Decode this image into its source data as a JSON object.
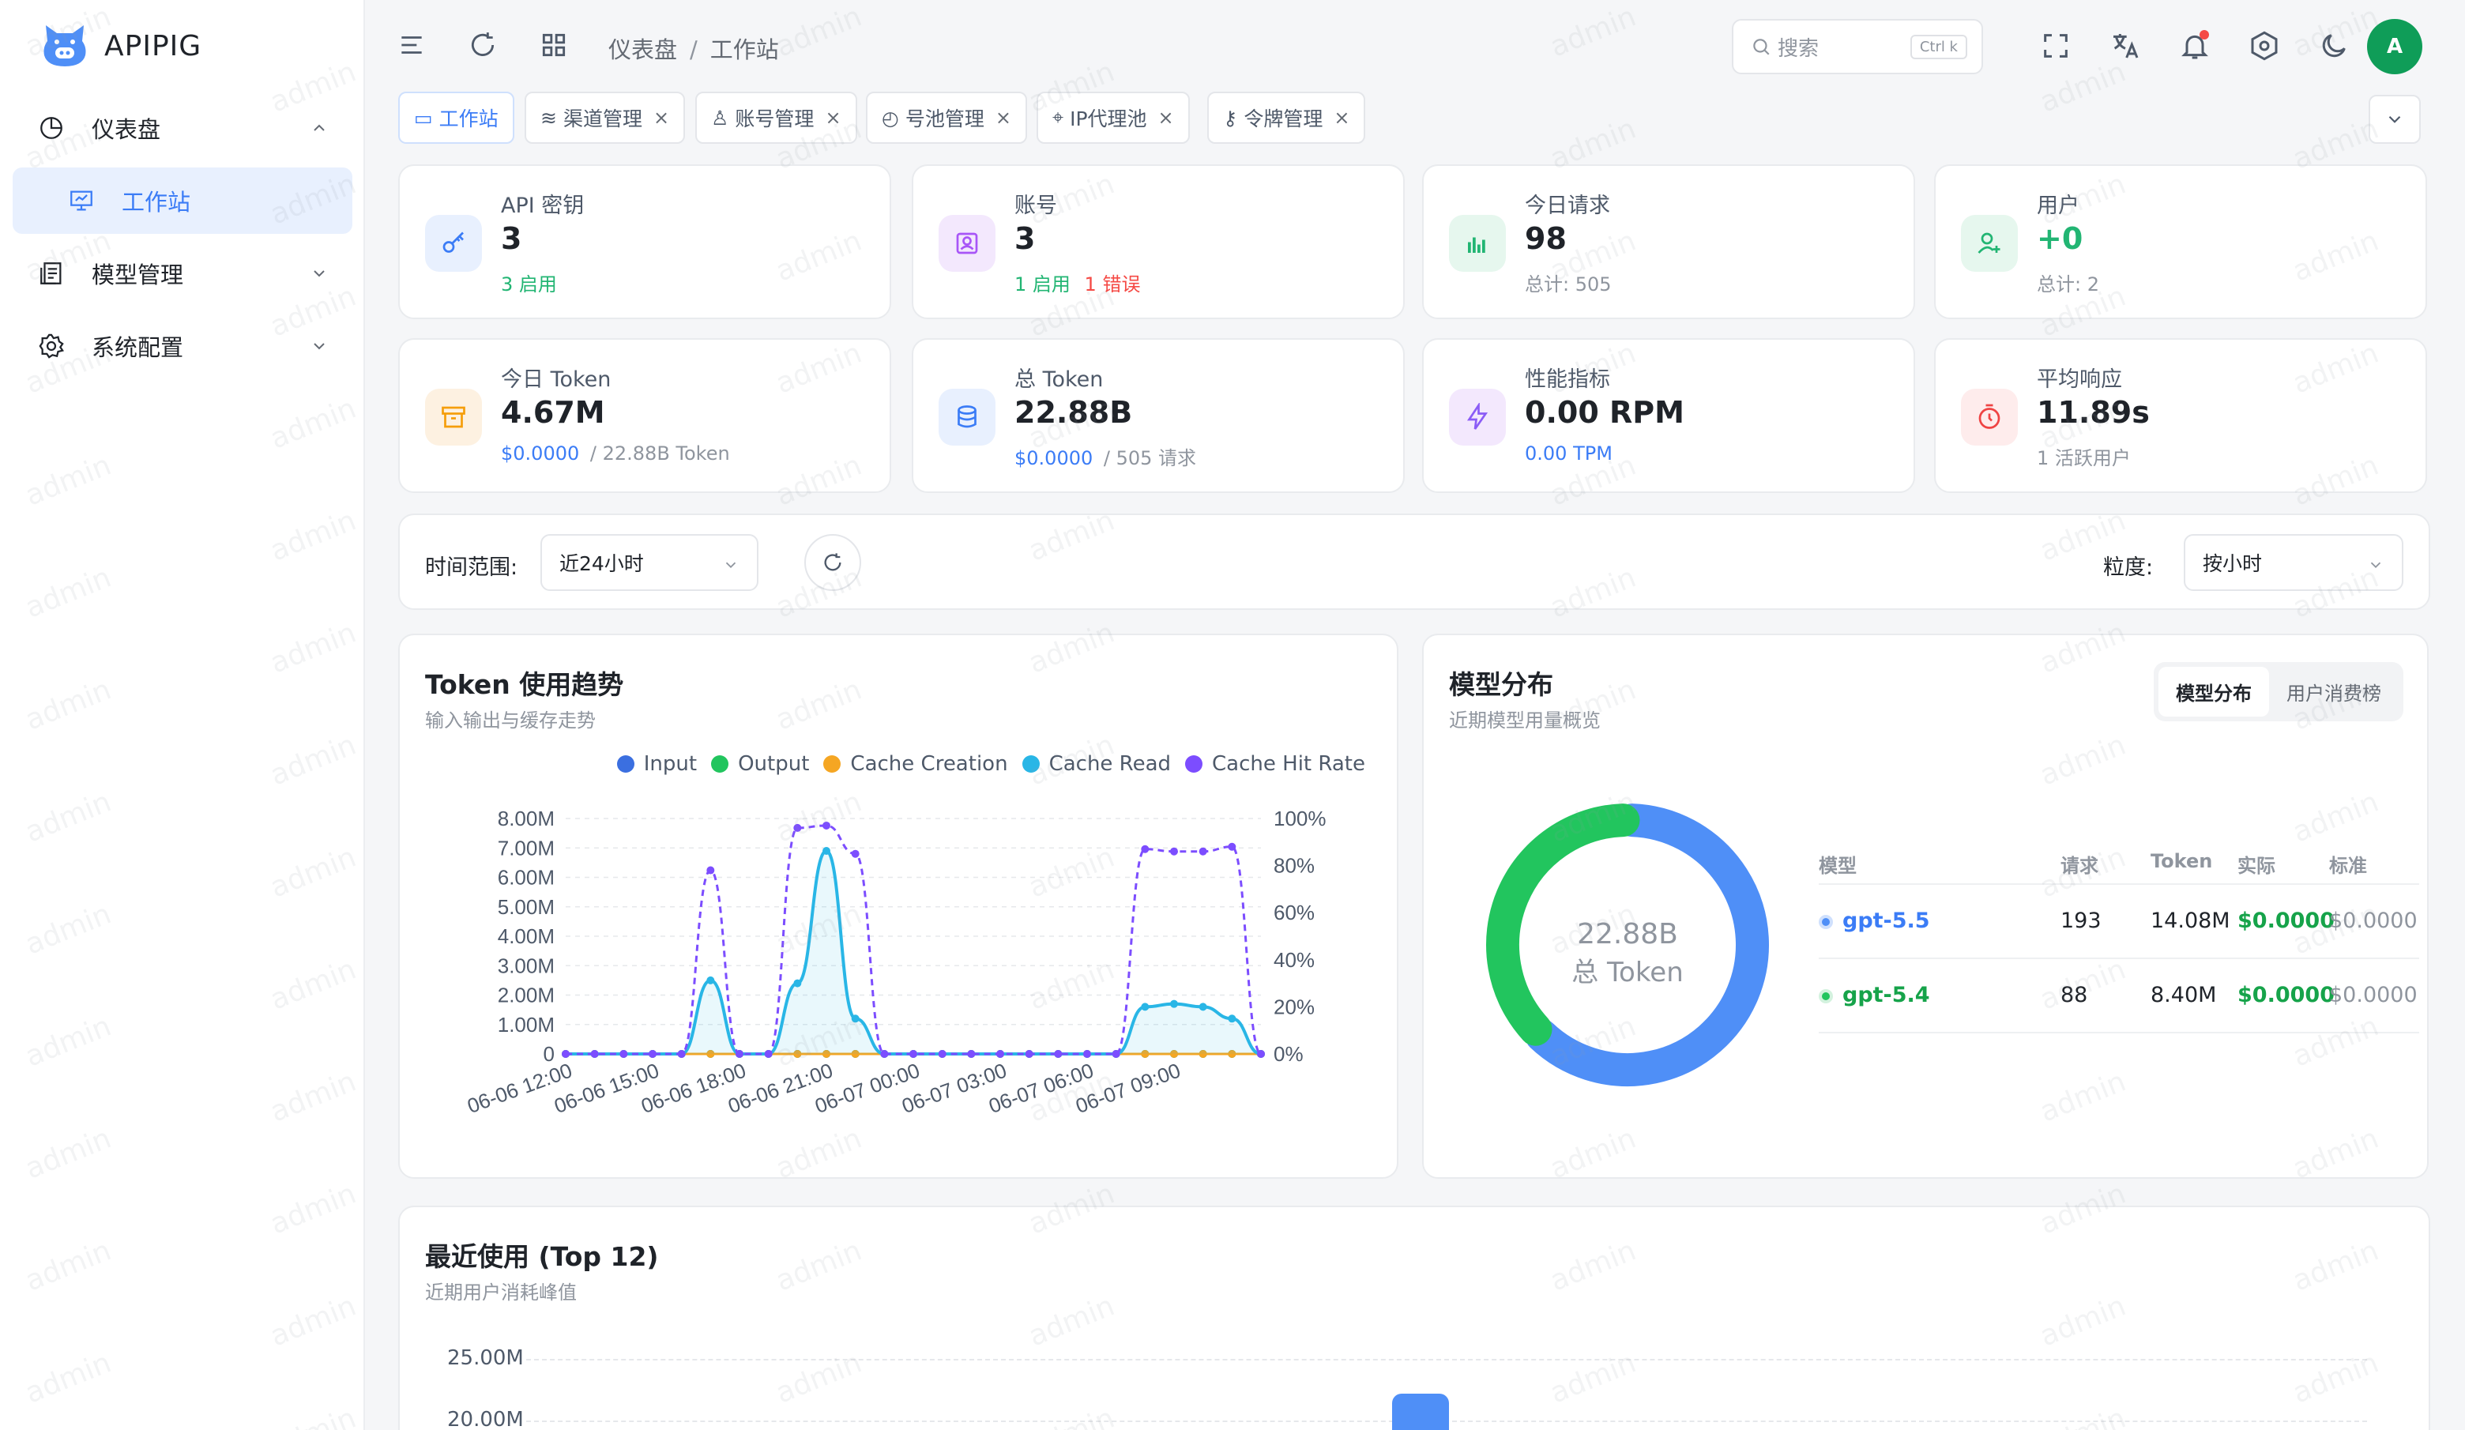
{
  "app": {
    "name": "APIPIG"
  },
  "sidebar": {
    "items": [
      {
        "label": "仪表盘"
      },
      {
        "label": "工作站"
      },
      {
        "label": "模型管理"
      },
      {
        "label": "系统配置"
      }
    ]
  },
  "header": {
    "breadcrumb": [
      "仪表盘",
      "工作站"
    ],
    "breadcrumb_sep": "/",
    "search_placeholder": "搜索",
    "search_shortcut": "Ctrl k",
    "avatar_initial": "A"
  },
  "tabs": [
    {
      "label": "工作站",
      "active": true
    },
    {
      "label": "渠道管理"
    },
    {
      "label": "账号管理"
    },
    {
      "label": "号池管理"
    },
    {
      "label": "IP代理池"
    },
    {
      "label": "令牌管理"
    }
  ],
  "tab_close": "×",
  "stats": {
    "api_keys": {
      "label": "API 密钥",
      "value": "3",
      "sub": "3 启用"
    },
    "accounts": {
      "label": "账号",
      "value": "3",
      "sub_ok": "1 启用",
      "sub_err": "1 错误"
    },
    "today_requests": {
      "label": "今日请求",
      "value": "98",
      "sub": "总计: 505"
    },
    "users": {
      "label": "用户",
      "value": "+0",
      "sub": "总计: 2"
    },
    "today_token": {
      "label": "今日 Token",
      "value": "4.67M",
      "sub_cost": "$0.0000",
      "sub_rest": "/ 22.88B Token"
    },
    "total_token": {
      "label": "总 Token",
      "value": "22.88B",
      "sub_cost": "$0.0000",
      "sub_rest": "/ 505 请求"
    },
    "perf": {
      "label": "性能指标",
      "value": "0.00 RPM",
      "sub": "0.00 TPM"
    },
    "avg_resp": {
      "label": "平均响应",
      "value": "11.89s",
      "sub": "1 活跃用户"
    }
  },
  "filters": {
    "range_label": "时间范围:",
    "range_value": "近24小时",
    "granularity_label": "粒度:",
    "granularity_value": "按小时"
  },
  "token_trend": {
    "title": "Token 使用趋势",
    "subtitle": "输入输出与缓存走势"
  },
  "model_dist": {
    "title": "模型分布",
    "subtitle": "近期模型用量概览",
    "seg": [
      "模型分布",
      "用户消费榜"
    ],
    "center_value": "22.88B",
    "center_label": "总 Token",
    "headers": [
      "模型",
      "请求",
      "Token",
      "实际",
      "标准"
    ],
    "rows": [
      {
        "model": "gpt-5.5",
        "requests": "193",
        "token": "14.08M",
        "actual": "$0.0000",
        "standard": "$0.0000",
        "color": "#4f8ff7"
      },
      {
        "model": "gpt-5.4",
        "requests": "88",
        "token": "8.40M",
        "actual": "$0.0000",
        "standard": "$0.0000",
        "color": "#22c55e"
      }
    ]
  },
  "recent": {
    "title": "最近使用 (Top 12)",
    "subtitle": "近期用户消耗峰值"
  },
  "watermark": "admin",
  "colors": {
    "input": "#3b6fe0",
    "output": "#22c55e",
    "cache_creation": "#f5a623",
    "cache_read": "#29b6e6",
    "cache_hit_rate": "#7c4dff"
  },
  "chart_data": [
    {
      "type": "line",
      "title": "Token 使用趋势",
      "x": [
        "06-06 12:00",
        "06-06 13:00",
        "06-06 14:00",
        "06-06 15:00",
        "06-06 16:00",
        "06-06 17:00",
        "06-06 18:00",
        "06-06 19:00",
        "06-06 20:00",
        "06-06 21:00",
        "06-06 22:00",
        "06-06 23:00",
        "06-07 00:00",
        "06-07 01:00",
        "06-07 02:00",
        "06-07 03:00",
        "06-07 04:00",
        "06-07 05:00",
        "06-07 06:00",
        "06-07 07:00",
        "06-07 08:00",
        "06-07 09:00",
        "06-07 10:00",
        "06-07 11:00",
        "06-07 12:00"
      ],
      "x_ticks": [
        "06-06 12:00",
        "06-06 15:00",
        "06-06 18:00",
        "06-06 21:00",
        "06-07 00:00",
        "06-07 03:00",
        "06-07 06:00",
        "06-07 09:00"
      ],
      "y_ticks": [
        "0",
        "1.00M",
        "2.00M",
        "3.00M",
        "4.00M",
        "5.00M",
        "6.00M",
        "7.00M",
        "8.00M"
      ],
      "y2_ticks": [
        "0%",
        "20%",
        "40%",
        "60%",
        "80%",
        "100%"
      ],
      "ylim": [
        0,
        8000000
      ],
      "y2lim": [
        0,
        100
      ],
      "series": [
        {
          "name": "Input",
          "axis": "left",
          "values": [
            0,
            0,
            0,
            0,
            0,
            0,
            0,
            0,
            0,
            0,
            0,
            0,
            0,
            0,
            0,
            0,
            0,
            0,
            0,
            0,
            0,
            0,
            0,
            0,
            0
          ]
        },
        {
          "name": "Output",
          "axis": "left",
          "values": [
            0,
            0,
            0,
            0,
            0,
            0,
            0,
            0,
            0,
            0,
            0,
            0,
            0,
            0,
            0,
            0,
            0,
            0,
            0,
            0,
            0,
            0,
            0,
            0,
            0
          ]
        },
        {
          "name": "Cache Creation",
          "axis": "left",
          "values": [
            0,
            0,
            0,
            0,
            0,
            0,
            0,
            0,
            0,
            0,
            0,
            0,
            0,
            0,
            0,
            0,
            0,
            0,
            0,
            0,
            0,
            0,
            0,
            0,
            0
          ]
        },
        {
          "name": "Cache Read",
          "axis": "left",
          "values": [
            0,
            0,
            0,
            0,
            0,
            2500000,
            0,
            0,
            2400000,
            6900000,
            1200000,
            0,
            0,
            0,
            0,
            0,
            0,
            0,
            0,
            0,
            1600000,
            1700000,
            1600000,
            1200000,
            0
          ]
        },
        {
          "name": "Cache Hit Rate",
          "axis": "right",
          "values": [
            0,
            0,
            0,
            0,
            0,
            78,
            0,
            0,
            96,
            97,
            85,
            0,
            0,
            0,
            0,
            0,
            0,
            0,
            0,
            0,
            87,
            86,
            86,
            88,
            0
          ]
        }
      ]
    },
    {
      "type": "pie",
      "title": "模型分布",
      "categories": [
        "gpt-5.5",
        "gpt-5.4"
      ],
      "values": [
        14.08,
        8.4
      ],
      "unit": "M Token"
    },
    {
      "type": "bar",
      "title": "最近使用 (Top 12)",
      "y_ticks_visible": [
        "25.00M",
        "20.00M"
      ]
    }
  ]
}
